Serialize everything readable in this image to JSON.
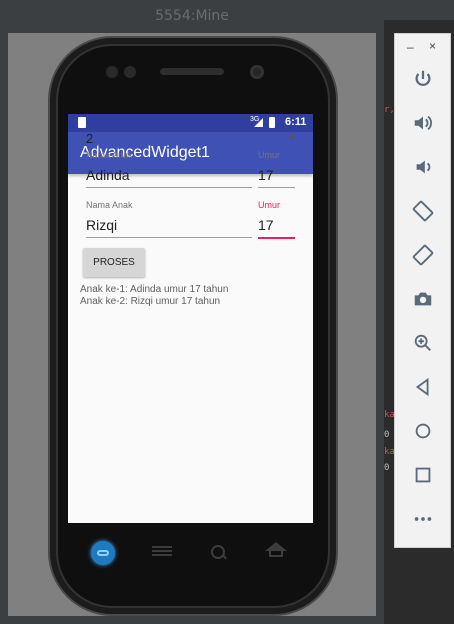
{
  "window": {
    "title": "5554:Mine"
  },
  "status_bar": {
    "network": "3G",
    "time": "6:11"
  },
  "app_bar": {
    "title": "AdvancedWidget1"
  },
  "spinner": {
    "selected": "2"
  },
  "children": [
    {
      "name_label": "Nama Anak",
      "name_value": "Adinda",
      "age_label": "Umur",
      "age_value": "17"
    },
    {
      "name_label": "Nama Anak",
      "name_value": "Rizqi",
      "age_label": "Umur",
      "age_value": "17"
    }
  ],
  "proses_button": {
    "label": "PROSES"
  },
  "results": [
    "Anak ke-1: Adinda umur 17 tahun",
    "Anak ke-2: Rizqi umur 17 tahun"
  ],
  "toolbar": {
    "minimize": "–",
    "close": "×",
    "buttons": [
      "power-icon",
      "volume-up-icon",
      "volume-down-icon",
      "rotate-left-icon",
      "rotate-right-icon",
      "camera-icon",
      "zoom-icon",
      "back-icon",
      "home-icon",
      "overview-icon",
      "more-icon"
    ]
  },
  "colors": {
    "primary": "#3f51b5",
    "primary_dark": "#303f9f",
    "accent": "#e91e63"
  }
}
